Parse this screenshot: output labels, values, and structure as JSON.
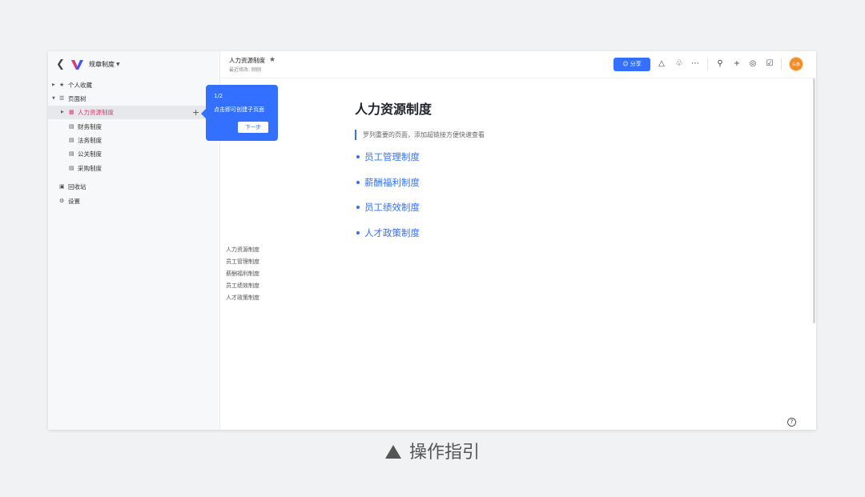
{
  "sidebar": {
    "space_name": "规章制度",
    "items": [
      {
        "label": "个人收藏",
        "icon": "star-icon"
      },
      {
        "label": "页面树",
        "icon": "tree-icon"
      },
      {
        "label": "人力资源制度",
        "icon": "document-icon"
      },
      {
        "label": "财务制度",
        "icon": "document-icon"
      },
      {
        "label": "法务制度",
        "icon": "document-icon"
      },
      {
        "label": "公关制度",
        "icon": "document-icon"
      },
      {
        "label": "采购制度",
        "icon": "document-icon"
      },
      {
        "label": "回收站",
        "icon": "trash-icon"
      },
      {
        "label": "设置",
        "icon": "gear-icon"
      }
    ]
  },
  "guide": {
    "step": "1/2",
    "text": "点击即可创建子页面",
    "next_label": "下一步"
  },
  "header": {
    "doc_title": "人力资源制度",
    "meta": "最近修改: 刚刚",
    "share_label": "分享",
    "avatar_text": "头像"
  },
  "outline": [
    "人力资源制度",
    "员工管理制度",
    "薪酬福利制度",
    "员工绩效制度",
    "人才政策制度"
  ],
  "page": {
    "title": "人力资源制度",
    "quote": "罗列重要的页面，添加超链接方便快速查看",
    "links": [
      "员工管理制度",
      "薪酬福利制度",
      "员工绩效制度",
      "人才政策制度"
    ]
  },
  "caption": "操作指引",
  "colors": {
    "accent": "#3370ff",
    "active": "#e8336b",
    "avatar": "#f28c28"
  }
}
